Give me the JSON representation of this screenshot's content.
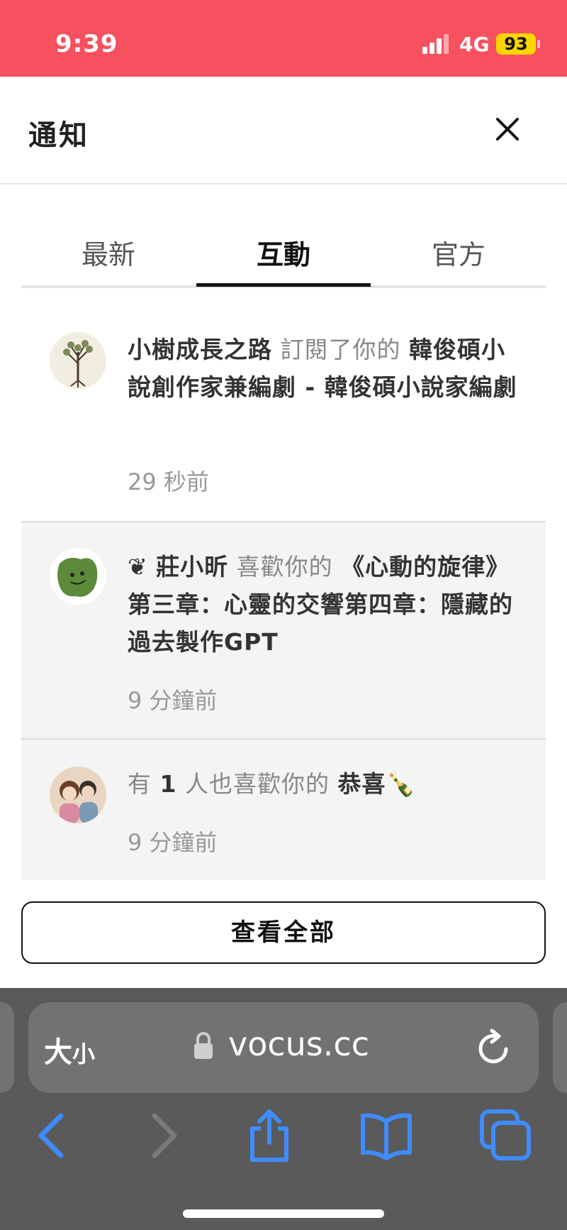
{
  "status_bar": {
    "time": "9:39",
    "network": "4G",
    "battery": "93",
    "bg_color": "#f7505f",
    "battery_color": "#ffd500"
  },
  "header": {
    "title": "通知",
    "close_icon": "close-icon"
  },
  "tabs": [
    {
      "label": "最新",
      "active": false
    },
    {
      "label": "互動",
      "active": true
    },
    {
      "label": "官方",
      "active": false
    }
  ],
  "notifications": [
    {
      "user": "小樹成長之路",
      "action": "訂閱了你的",
      "target": "韓俊碩小說創作家兼編劇 - 韓俊碩小說家編劇",
      "time": "29 秒前",
      "avatar_icon": "tree-avatar"
    },
    {
      "user_prefix": "❦",
      "user": "莊小昕",
      "action": "喜歡你的",
      "target": "《心動的旋律》第三章：心靈的交響第四章：隱藏的過去製作GPT",
      "time": "9 分鐘前",
      "avatar_icon": "green-blob-avatar"
    },
    {
      "prefix": "有",
      "count": "1",
      "action": "人也喜歡你的",
      "target": "恭喜🍾",
      "time": "9 分鐘前",
      "avatar_icon": "illustration-avatar"
    }
  ],
  "view_all_label": "查看全部",
  "browser": {
    "text_size_label": "大",
    "text_size_small": "小",
    "domain": "vocus.cc",
    "accent_color": "#3f8cff",
    "icons": [
      "back-icon",
      "forward-icon",
      "share-icon",
      "bookmarks-icon",
      "tabs-icon",
      "reload-icon",
      "lock-icon"
    ]
  }
}
